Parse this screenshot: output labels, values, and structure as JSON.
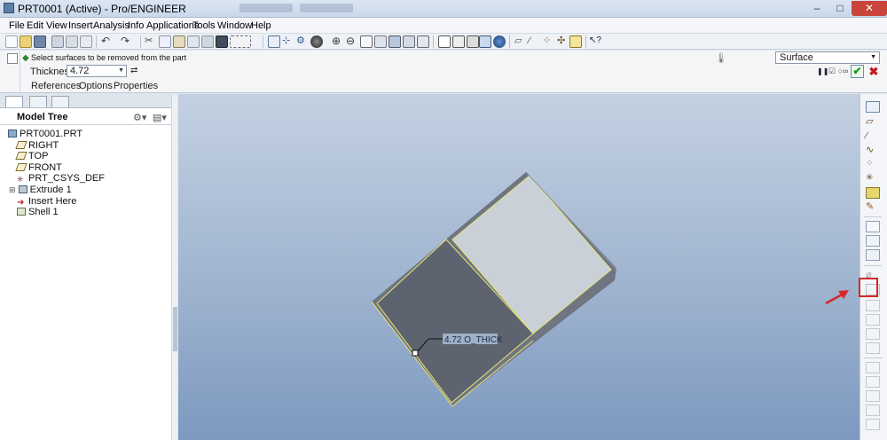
{
  "window": {
    "title": "PRT0001 (Active) - Pro/ENGINEER",
    "minimize": "–",
    "maximize": "□",
    "close": "✕"
  },
  "menu": [
    "File",
    "Edit",
    "View",
    "Insert",
    "Analysis",
    "Info",
    "Applications",
    "Tools",
    "Window",
    "Help"
  ],
  "dashboard": {
    "message": "Select surfaces to be removed from the part",
    "thickness_label": "Thickness",
    "thickness_value": "4.72",
    "flip_icon": "⇄",
    "tabs": [
      "References",
      "Options",
      "Properties"
    ],
    "filter_value": "Surface",
    "pause": "❚❚",
    "preview": "☑ ○∞",
    "ok": "✔",
    "cancel": "✖"
  },
  "model_tree": {
    "title": "Model Tree",
    "nodes": [
      {
        "label": "PRT0001.PRT",
        "icon": "part-icon"
      },
      {
        "label": "RIGHT",
        "icon": "datum-plane-icon"
      },
      {
        "label": "TOP",
        "icon": "datum-plane-icon"
      },
      {
        "label": "FRONT",
        "icon": "datum-plane-icon"
      },
      {
        "label": "PRT_CSYS_DEF",
        "icon": "csys-icon"
      },
      {
        "label": "Extrude 1",
        "icon": "extrude-icon"
      },
      {
        "label": "Insert Here",
        "icon": "insert-arrow-icon"
      },
      {
        "label": "Shell 1",
        "icon": "shell-icon"
      }
    ]
  },
  "viewport": {
    "dimension_label": "4.72 O_THICK"
  },
  "colors": {
    "viewport_top": "#c4d1e2",
    "viewport_bottom": "#7d99c0",
    "dark_face": "#5e6370",
    "light_face": "#c9d0d8",
    "edge_highlight": "#e4e37a",
    "annotation_red": "#d8272a"
  }
}
